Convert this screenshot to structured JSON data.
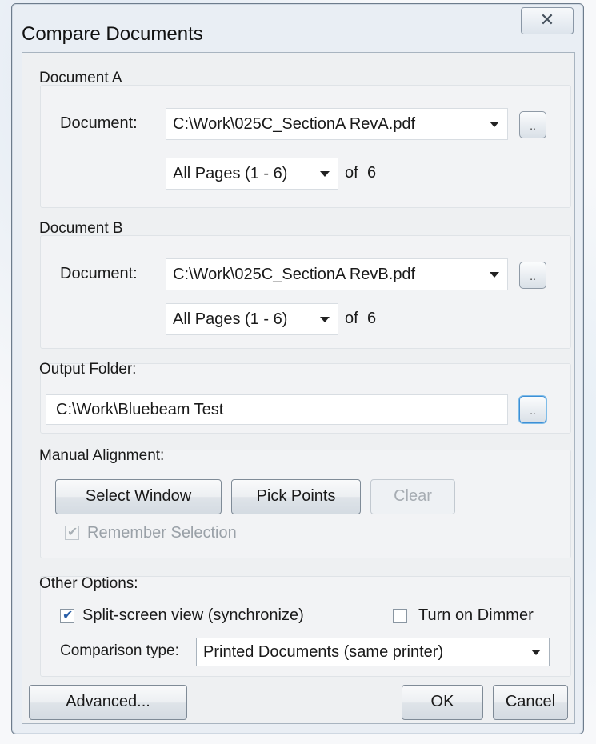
{
  "window": {
    "title": "Compare Documents",
    "close_glyph": "✕"
  },
  "doc_a": {
    "group_label": "Document A",
    "doc_label": "Document:",
    "path": "C:\\Work\\025C_SectionA RevA.pdf",
    "pages": "All Pages (1 - 6)",
    "of_label": "of",
    "page_count": "6",
    "browse_label": ".."
  },
  "doc_b": {
    "group_label": "Document B",
    "doc_label": "Document:",
    "path": "C:\\Work\\025C_SectionA RevB.pdf",
    "pages": "All Pages (1 - 6)",
    "of_label": "of",
    "page_count": "6",
    "browse_label": ".."
  },
  "output": {
    "group_label": "Output Folder:",
    "path": "C:\\Work\\Bluebeam Test",
    "browse_label": ".."
  },
  "alignment": {
    "group_label": "Manual Alignment:",
    "select_window": "Select Window",
    "pick_points": "Pick Points",
    "clear": "Clear",
    "remember": "Remember Selection",
    "remember_checked": true
  },
  "options": {
    "group_label": "Other Options:",
    "split_screen": "Split-screen view (synchronize)",
    "split_screen_checked": true,
    "dimmer": "Turn on Dimmer",
    "dimmer_checked": false,
    "comparison_label": "Comparison type:",
    "comparison_value": "Printed Documents (same printer)"
  },
  "footer": {
    "advanced": "Advanced...",
    "ok": "OK",
    "cancel": "Cancel"
  },
  "colors": {
    "dialog_bg": "#e9eef4",
    "focus_accent": "#3d8fd6",
    "check_color": "#2a5fa8"
  }
}
